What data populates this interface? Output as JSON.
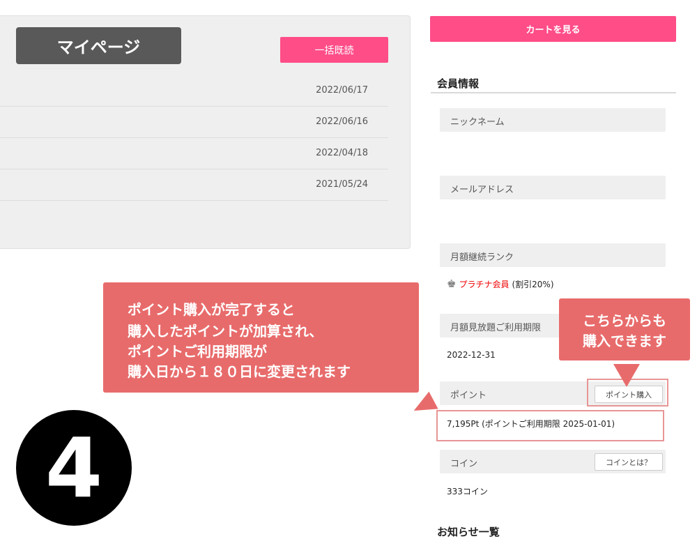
{
  "mypage": {
    "title": "マイページ",
    "mark_all_read": "一括既読",
    "notices": [
      "2022/06/17",
      "2022/06/16",
      "2022/04/18",
      "2021/05/24"
    ]
  },
  "sidebar": {
    "cart_button": "カートを見る",
    "member_info_title": "会員情報",
    "nickname_label": "ニックネーム",
    "email_label": "メールアドレス",
    "monthly_rank_label": "月額継続ランク",
    "rank_name": "プラチナ会員",
    "rank_discount": "(割引20%)",
    "subscription_label": "月額見放題ご利用期限",
    "subscription_value": "2022-12-31",
    "points_label": "ポイント",
    "buy_points_button": "ポイント購入",
    "points_value": "7,195Pt (ポイントご利用期限 2025-01-01)",
    "coins_label": "コイン",
    "coins_help_button": "コインとは？",
    "coins_value": "333コイン",
    "news_title": "お知らせ一覧"
  },
  "annotations": {
    "main_callout": [
      "ポイント購入が完了すると",
      "購入したポイントが加算され、",
      "ポイントご利用期限が",
      "購入日から１８０日に変更されます"
    ],
    "side_callout": [
      "こちらからも",
      "購入できます"
    ],
    "step_number": "4"
  },
  "colors": {
    "accent": "#ff4d88",
    "callout": "#e86b6b",
    "panel": "#efefef",
    "badge": "#595959"
  }
}
